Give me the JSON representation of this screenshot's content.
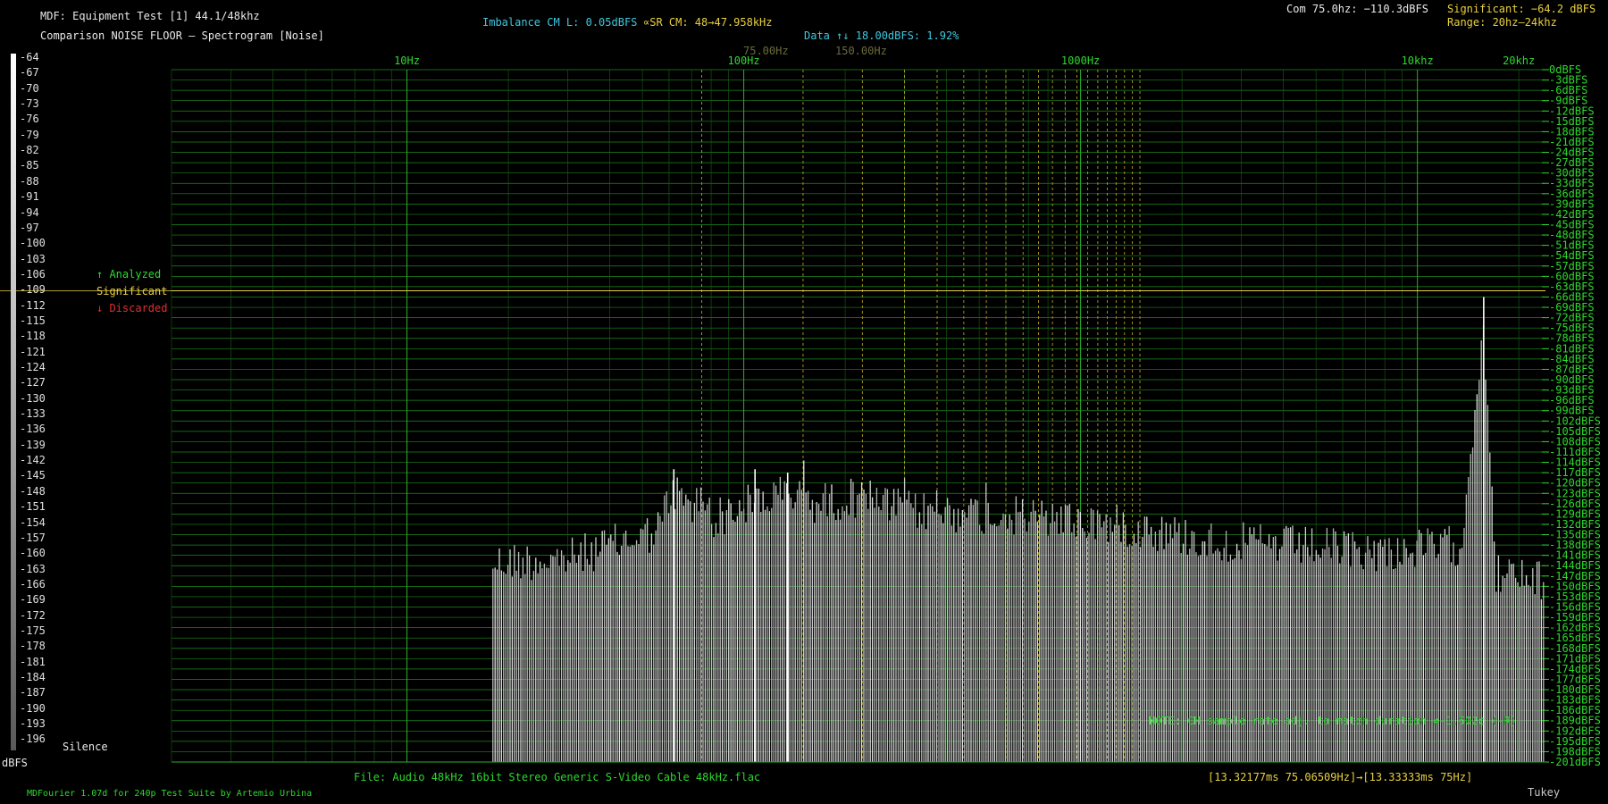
{
  "header": {
    "title": "MDF: Equipment Test [1] 44.1/48khz",
    "subtitle": "Comparison NOISE FLOOR – Spectrogram [Noise]",
    "imbalance": "Imbalance CM L: 0.05dBFS",
    "sr_cm": "∝SR CM: 48→47.958kHz",
    "data_info": "Data ↑↓ 18.00dBFS: 1.92%",
    "marker_75": "75.00Hz",
    "marker_150": "150.00Hz",
    "com": "Com 75.0hz: −110.3dBFS",
    "significant": "Significant: −64.2 dBFS",
    "range": "Range: 20hz–24khz"
  },
  "legend": {
    "analyzed": "↑ Analyzed",
    "significant": "Significant",
    "discarded": "↓ Discarded"
  },
  "scale": {
    "labels": [
      "-64",
      "-67",
      "-70",
      "-73",
      "-76",
      "-79",
      "-82",
      "-85",
      "-88",
      "-91",
      "-94",
      "-97",
      "-100",
      "-103",
      "-106",
      "-109",
      "-112",
      "-115",
      "-118",
      "-121",
      "-124",
      "-127",
      "-130",
      "-133",
      "-136",
      "-139",
      "-142",
      "-145",
      "-148",
      "-151",
      "-154",
      "-157",
      "-160",
      "-163",
      "-166",
      "-169",
      "-172",
      "-175",
      "-178",
      "-181",
      "-184",
      "-187",
      "-190",
      "-193",
      "-196"
    ],
    "silence": "Silence",
    "unit": "dBFS"
  },
  "footer": {
    "file": "File: Audio    48kHz 16bit Stereo Generic S-Video Cable 48kHz.flac",
    "range_readout": "[13.32177ms 75.06509Hz]→[13.33333ms 75Hz]",
    "credit": "MDFourier 1.07d for 240p Test Suite by Artemio Urbina",
    "window": "Tukey",
    "note": "NOTE: CM sample rate adj. to match duration ≠−1.502¢ (−R)"
  },
  "chart_data": {
    "type": "bar",
    "x_scale": "log",
    "xlim": [
      2,
      24000
    ],
    "ylim": [
      -201,
      0
    ],
    "x_ticks": [
      {
        "value": 10,
        "label": "10Hz"
      },
      {
        "value": 100,
        "label": "100Hz"
      },
      {
        "value": 1000,
        "label": "1000Hz"
      },
      {
        "value": 10000,
        "label": "10khz"
      },
      {
        "value": 20000,
        "label": "20khz"
      }
    ],
    "y_tick_labels": [
      "0dBFS",
      "-3dBFS",
      "-6dBFS",
      "-9dBFS",
      "-12dBFS",
      "-15dBFS",
      "-18dBFS",
      "-21dBFS",
      "-24dBFS",
      "-27dBFS",
      "-30dBFS",
      "-33dBFS",
      "-36dBFS",
      "-39dBFS",
      "-42dBFS",
      "-45dBFS",
      "-48dBFS",
      "-51dBFS",
      "-54dBFS",
      "-57dBFS",
      "-60dBFS",
      "-63dBFS",
      "-66dBFS",
      "-69dBFS",
      "-72dBFS",
      "-75dBFS",
      "-78dBFS",
      "-81dBFS",
      "-84dBFS",
      "-87dBFS",
      "-90dBFS",
      "-93dBFS",
      "-96dBFS",
      "-99dBFS",
      "-102dBFS",
      "-105dBFS",
      "-108dBFS",
      "-111dBFS",
      "-114dBFS",
      "-117dBFS",
      "-120dBFS",
      "-123dBFS",
      "-126dBFS",
      "-129dBFS",
      "-132dBFS",
      "-135dBFS",
      "-138dBFS",
      "-141dBFS",
      "-144dBFS",
      "-147dBFS",
      "-150dBFS",
      "-153dBFS",
      "-156dBFS",
      "-159dBFS",
      "-162dBFS",
      "-165dBFS",
      "-168dBFS",
      "-171dBFS",
      "-174dBFS",
      "-177dBFS",
      "-180dBFS",
      "-183dBFS",
      "-186dBFS",
      "-189dBFS",
      "-192dBFS",
      "-195dBFS",
      "-198dBFS",
      "-201dBFS"
    ],
    "significant_level": -64.2,
    "harmonic_markers": [
      75,
      150,
      225,
      300,
      375,
      450,
      525,
      600,
      675,
      750,
      825,
      900,
      975,
      1050,
      1125,
      1200,
      1275,
      1350,
      1425,
      1500
    ],
    "envelope": [
      {
        "f": 18,
        "db": -137
      },
      {
        "f": 30,
        "db": -136
      },
      {
        "f": 55,
        "db": -128
      },
      {
        "f": 62,
        "db": -116
      },
      {
        "f": 75,
        "db": -126
      },
      {
        "f": 110,
        "db": -119
      },
      {
        "f": 135,
        "db": -117
      },
      {
        "f": 160,
        "db": -120
      },
      {
        "f": 220,
        "db": -118
      },
      {
        "f": 300,
        "db": -122
      },
      {
        "f": 480,
        "db": -123
      },
      {
        "f": 700,
        "db": -124
      },
      {
        "f": 1000,
        "db": -125
      },
      {
        "f": 1500,
        "db": -127
      },
      {
        "f": 2500,
        "db": -131
      },
      {
        "f": 4000,
        "db": -132
      },
      {
        "f": 8000,
        "db": -134
      },
      {
        "f": 13500,
        "db": -132
      },
      {
        "f": 15734,
        "db": -66
      },
      {
        "f": 17000,
        "db": -140
      },
      {
        "f": 24000,
        "db": -143
      }
    ],
    "peaks": [
      {
        "f": 15734,
        "db": -66
      },
      {
        "f": 62,
        "db": -116
      },
      {
        "f": 108,
        "db": -116
      },
      {
        "f": 135,
        "db": -117
      }
    ]
  }
}
